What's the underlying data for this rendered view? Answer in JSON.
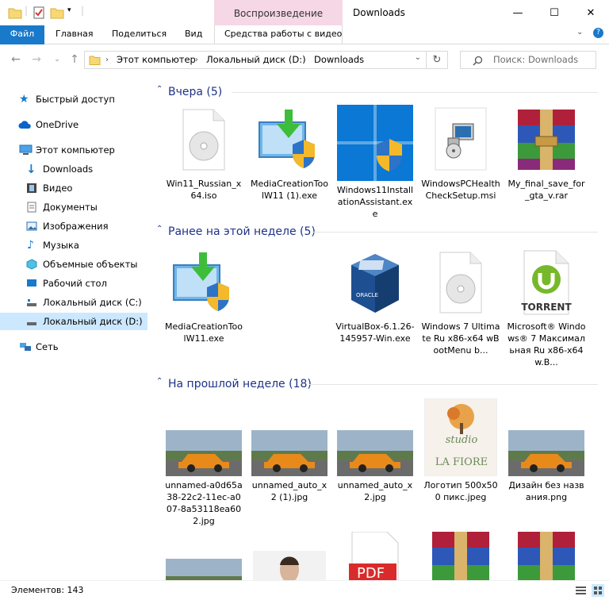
{
  "window": {
    "title": "Downloads",
    "context_tab_header": "Воспроизведение",
    "minimize": "—",
    "maximize": "☐",
    "close": "✕"
  },
  "ribbon": {
    "file": "Файл",
    "home": "Главная",
    "share": "Поделиться",
    "view": "Вид",
    "video_tools": "Средства работы с видео"
  },
  "address": {
    "crumbs": [
      "Этот компьютер",
      "Локальный диск (D:)",
      "Downloads"
    ],
    "search_placeholder": "Поиск: Downloads"
  },
  "nav": {
    "quick_access": "Быстрый доступ",
    "onedrive": "OneDrive",
    "this_pc": "Этот компьютер",
    "downloads": "Downloads",
    "video": "Видео",
    "documents": "Документы",
    "pictures": "Изображения",
    "music": "Музыка",
    "objects3d": "Объемные объекты",
    "desktop": "Рабочий стол",
    "disk_c": "Локальный диск (C:)",
    "disk_d": "Локальный диск (D:)",
    "network": "Сеть"
  },
  "groups": {
    "yesterday": "Вчера (5)",
    "this_week": "Ранее на этой неделе (5)",
    "last_week": "На прошлой неделе (18)"
  },
  "files_yesterday": [
    {
      "name": "Win11_Russian_x64.iso",
      "icon": "iso-disc-icon"
    },
    {
      "name": "MediaCreationToolW11 (1).exe",
      "icon": "media-creation-tool-icon"
    },
    {
      "name": "Windows11InstallationAssistant.exe",
      "icon": "windows11-installer-icon"
    },
    {
      "name": "WindowsPCHealthCheckSetup.msi",
      "icon": "msi-installer-icon"
    },
    {
      "name": "My_final_save_for_gta_v.rar",
      "icon": "winrar-archive-icon"
    }
  ],
  "files_this_week": [
    {
      "name": "MediaCreationToolW11.exe",
      "icon": "media-creation-tool-icon"
    },
    {
      "name": "VirtualBox-6.1.26-145957-Win.exe",
      "icon": "virtualbox-icon"
    },
    {
      "name": "Windows 7 Ultimate Ru x86-x64 wBootMenu b...",
      "icon": "iso-disc-icon"
    },
    {
      "name": "Microsoft® Windows® 7 Максимальная Ru x86-x64 w.B...",
      "icon": "utorrent-file-icon"
    }
  ],
  "files_last_week": [
    {
      "name": "unnamed-a0d65a38-22c2-11ec-a007-8a53118ea602.jpg",
      "icon": "car-photo-thumbnail"
    },
    {
      "name": "unnamed_auto_x2 (1).jpg",
      "icon": "car-photo-thumbnail"
    },
    {
      "name": "unnamed_auto_x2.jpg",
      "icon": "car-photo-thumbnail"
    },
    {
      "name": "Логотип 500x500 пикс.jpeg",
      "icon": "logo-thumbnail"
    },
    {
      "name": "Дизайн без названия.png",
      "icon": "car-photo-thumbnail"
    }
  ],
  "torrent_label": "TORRENT",
  "logo_text": {
    "studio": "studio",
    "brand": "LA FIORE"
  },
  "pdf_label": "PDF",
  "status": {
    "items": "Элементов: 143"
  },
  "colors": {
    "accent": "#1979ca",
    "context_tab": "#f6d7e6",
    "group_title": "#1e3287",
    "selected": "#cce8ff"
  }
}
